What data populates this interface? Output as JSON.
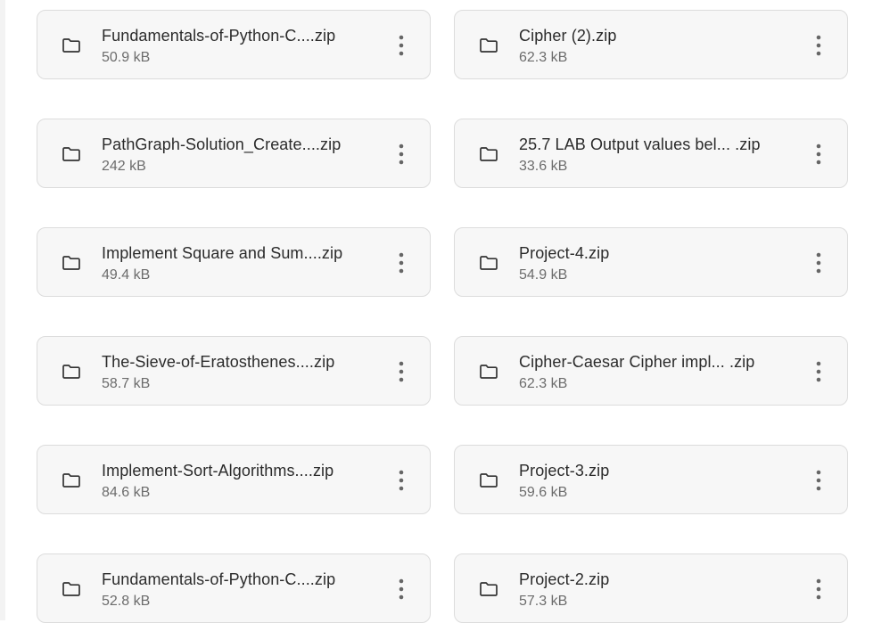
{
  "files": [
    {
      "name": "Fundamentals-of-Python-C....zip",
      "size": "50.9 kB",
      "icon": "folder-icon"
    },
    {
      "name": "Cipher (2).zip",
      "size": "62.3 kB",
      "icon": "folder-icon"
    },
    {
      "name": "PathGraph-Solution_Create....zip",
      "size": "242 kB",
      "icon": "folder-icon"
    },
    {
      "name": "25.7 LAB Output values bel... .zip",
      "size": "33.6 kB",
      "icon": "folder-icon"
    },
    {
      "name": "Implement Square and Sum....zip",
      "size": "49.4 kB",
      "icon": "folder-icon"
    },
    {
      "name": "Project-4.zip",
      "size": "54.9 kB",
      "icon": "folder-icon"
    },
    {
      "name": "The-Sieve-of-Eratosthenes....zip",
      "size": "58.7 kB",
      "icon": "folder-icon"
    },
    {
      "name": "Cipher-Caesar Cipher impl... .zip",
      "size": "62.3 kB",
      "icon": "folder-icon"
    },
    {
      "name": "Implement-Sort-Algorithms....zip",
      "size": "84.6 kB",
      "icon": "folder-icon"
    },
    {
      "name": "Project-3.zip",
      "size": "59.6 kB",
      "icon": "folder-icon"
    },
    {
      "name": "Fundamentals-of-Python-C....zip",
      "size": "52.8 kB",
      "icon": "folder-icon"
    },
    {
      "name": "Project-2.zip",
      "size": "57.3 kB",
      "icon": "folder-icon"
    }
  ],
  "colors": {
    "card_background": "#f7f7f7",
    "card_border": "#dcdcdc",
    "name_text": "#2b2b2b",
    "size_text": "#6c6c6c",
    "icon": "#333333"
  }
}
